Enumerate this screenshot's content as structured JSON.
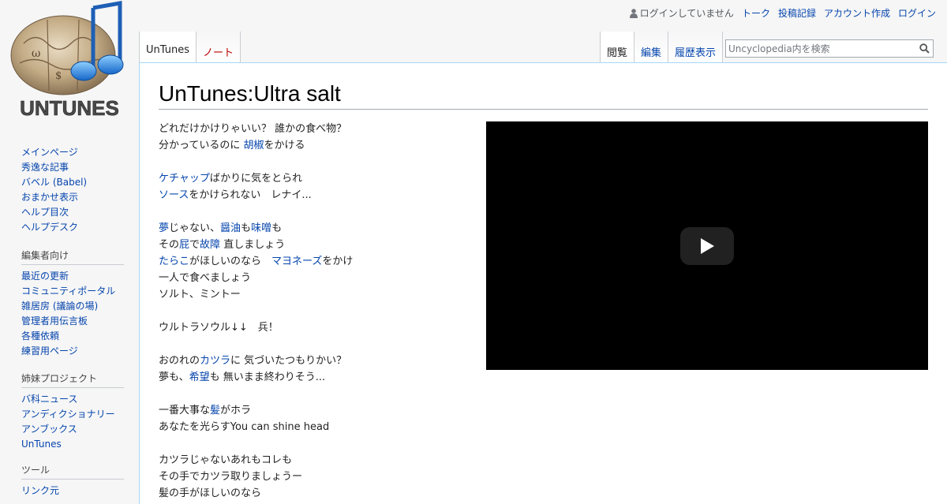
{
  "logo": {
    "text": "UNTUNES"
  },
  "personal_tools": {
    "anon_label": "ログインしていません",
    "talk": "トーク",
    "contributions": "投稿記録",
    "create_account": "アカウント作成",
    "login": "ログイン"
  },
  "tabs_left": [
    {
      "label": "UnTunes"
    },
    {
      "label": "ノート"
    }
  ],
  "tabs_right": [
    {
      "label": "閲覧"
    },
    {
      "label": "編集"
    },
    {
      "label": "履歴表示"
    }
  ],
  "search": {
    "placeholder": "Uncyclopedia内を検索",
    "icon": "search-icon"
  },
  "page_title": "UnTunes:Ultra salt",
  "lyrics": [
    [
      {
        "t": "どれだけかけりゃいい？ 誰かの食べ物？"
      }
    ],
    [
      {
        "t": "分かっているのに "
      },
      {
        "t": "胡椒",
        "l": 1
      },
      {
        "t": "をかける"
      }
    ],
    [],
    [
      {
        "t": "ケチャップ",
        "l": 1
      },
      {
        "t": "ばかりに気をとられ"
      }
    ],
    [
      {
        "t": "ソース",
        "l": 1
      },
      {
        "t": "をかけられない　レナイ..."
      }
    ],
    [],
    [
      {
        "t": "夢",
        "l": 1
      },
      {
        "t": "じゃない、"
      },
      {
        "t": "醤油",
        "l": 1
      },
      {
        "t": "も"
      },
      {
        "t": "味噌",
        "l": 1
      },
      {
        "t": "も"
      }
    ],
    [
      {
        "t": "その"
      },
      {
        "t": "屁",
        "l": 1
      },
      {
        "t": "で"
      },
      {
        "t": "故障",
        "l": 1
      },
      {
        "t": " 直しましょう"
      }
    ],
    [
      {
        "t": "たらこ",
        "l": 1
      },
      {
        "t": "がほしいのなら　"
      },
      {
        "t": "マヨネーズ",
        "l": 1
      },
      {
        "t": "をかけ"
      }
    ],
    [
      {
        "t": "一人で食べましょう"
      }
    ],
    [
      {
        "t": "ソルト、ミントー"
      }
    ],
    [],
    [
      {
        "t": "ウルトラソウル↓↓　兵！"
      }
    ],
    [],
    [
      {
        "t": "おのれの"
      },
      {
        "t": "カツラ",
        "l": 1
      },
      {
        "t": "に 気づいたつもりかい？"
      }
    ],
    [
      {
        "t": "夢も、"
      },
      {
        "t": "希望",
        "l": 1
      },
      {
        "t": "も 無いまま終わりそう..."
      }
    ],
    [],
    [
      {
        "t": "一番大事な"
      },
      {
        "t": "髪",
        "l": 1
      },
      {
        "t": "がホラ"
      }
    ],
    [
      {
        "t": "あなたを光らすYou can shine head"
      }
    ],
    [],
    [
      {
        "t": "カツラじゃないあれもコレも"
      }
    ],
    [
      {
        "t": "その手でカツラ取りましょうー"
      }
    ],
    [
      {
        "t": "髪の手がほしいのなら"
      }
    ]
  ],
  "video": {
    "play_icon": "play-button-icon"
  },
  "sidebar": {
    "navigation": [
      "メインページ",
      "秀逸な記事",
      "バベル (Babel)",
      "おまかせ表示",
      "ヘルプ目次",
      "ヘルプデスク"
    ],
    "editors": {
      "heading": "編集者向け",
      "items": [
        "最近の更新",
        "コミュニティポータル",
        "雑居房 (議論の場)",
        "管理者用伝言板",
        "各種依頼",
        "練習用ページ"
      ]
    },
    "sister": {
      "heading": "姉妹プロジェクト",
      "items": [
        "バ科ニュース",
        "アンディクショナリー",
        "アンブックス",
        "UnTunes"
      ]
    },
    "tools": {
      "heading": "ツール",
      "items": [
        "リンク元"
      ]
    }
  },
  "colors": {
    "link": "#0645ad",
    "new_link": "#ba0000",
    "border": "#a7d7f9"
  }
}
